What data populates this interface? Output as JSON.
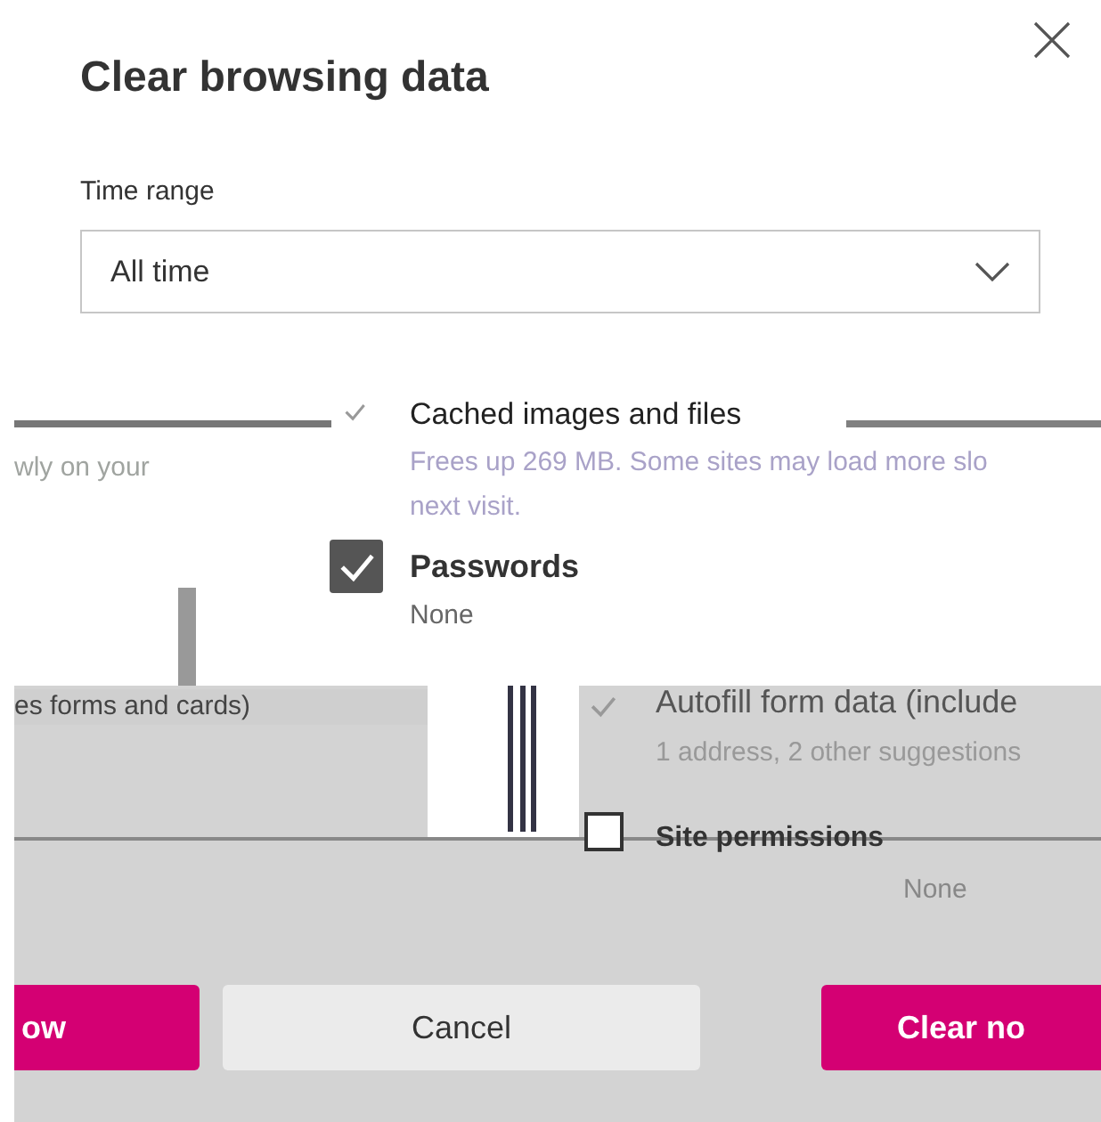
{
  "dialog": {
    "title": "Clear browsing data",
    "time_range": {
      "label": "Time range",
      "value": "All time"
    }
  },
  "items": [
    {
      "kind": "cached",
      "label": "Cached images and files",
      "detail": [
        "Frees up 269 MB. Some sites may load more slo",
        "next visit."
      ],
      "checked": true
    },
    {
      "kind": "passwords",
      "label": "Passwords",
      "detail": [
        "None"
      ],
      "checked": true
    },
    {
      "kind": "autofill",
      "label": "Autofill form data (include",
      "detail": [
        "1 address, 2 other suggestions"
      ],
      "checked": true
    },
    {
      "kind": "site",
      "label": "Site permissions",
      "detail": [
        "None"
      ],
      "checked": false
    }
  ],
  "fragments": [
    {
      "kind": "upper",
      "text": "wly on your"
    },
    {
      "kind": "lower",
      "text": "es forms and cards)"
    }
  ],
  "buttons": [
    {
      "kind": "primary",
      "label": "ow"
    },
    {
      "kind": "secondary",
      "label": "Cancel"
    },
    {
      "kind": "primary",
      "label": "Clear no"
    }
  ]
}
